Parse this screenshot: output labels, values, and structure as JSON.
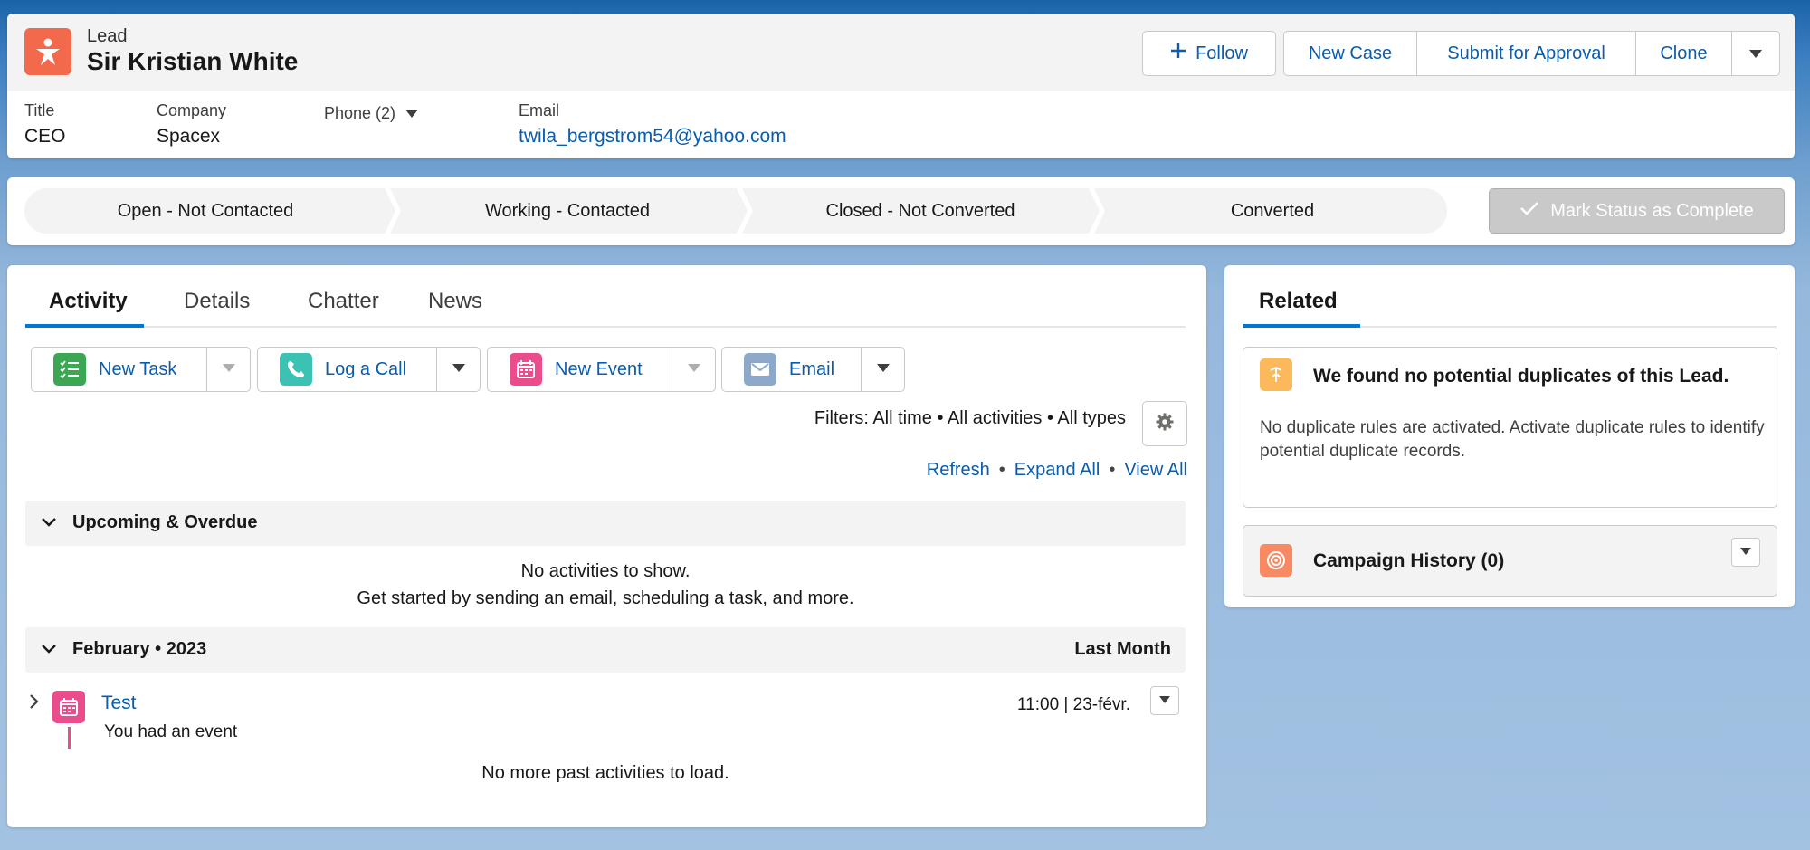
{
  "header": {
    "object_label": "Lead",
    "record_name": "Sir Kristian White",
    "actions": {
      "follow": "Follow",
      "new_case": "New Case",
      "submit_for_approval": "Submit for Approval",
      "clone": "Clone"
    },
    "fields": {
      "title_label": "Title",
      "title_value": "CEO",
      "company_label": "Company",
      "company_value": "Spacex",
      "phone_label": "Phone (2)",
      "email_label": "Email",
      "email_value": "twila_bergstrom54@yahoo.com"
    }
  },
  "path": {
    "stages": [
      "Open - Not Contacted",
      "Working - Contacted",
      "Closed - Not Converted",
      "Converted"
    ],
    "mark_complete": "Mark Status as Complete"
  },
  "activity": {
    "tabs": [
      "Activity",
      "Details",
      "Chatter",
      "News"
    ],
    "active_tab": "Activity",
    "actions": [
      "New Task",
      "Log a Call",
      "New Event",
      "Email"
    ],
    "filters_text": "Filters: All time • All activities • All types",
    "links": {
      "refresh": "Refresh",
      "expand_all": "Expand All",
      "view_all": "View All",
      "separator": "•"
    },
    "upcoming": {
      "title": "Upcoming & Overdue",
      "empty_line1": "No activities to show.",
      "empty_line2": "Get started by sending an email, scheduling a task, and more."
    },
    "month_section": {
      "title": "February • 2023",
      "right_label": "Last Month",
      "event": {
        "title": "Test",
        "subtitle": "You had an event",
        "time": "11:00 | 23-févr."
      },
      "no_more": "No more past activities to load."
    }
  },
  "related": {
    "tab": "Related",
    "duplicates": {
      "title": "We found no potential duplicates of this Lead.",
      "text": "No duplicate rules are activated. Activate duplicate rules to identify potential duplicate records."
    },
    "campaign_history": "Campaign History (0)"
  },
  "colors": {
    "brand_blue": "#0176d3",
    "link_blue": "#0b5cab",
    "lead_orange": "#f26a4b",
    "task_green": "#3ba755",
    "call_teal": "#3cc2b3",
    "event_pink": "#eb4c8b",
    "email_gray": "#8ca9c9",
    "dup_yellow": "#fcb95b",
    "campaign_orange": "#f88962"
  }
}
